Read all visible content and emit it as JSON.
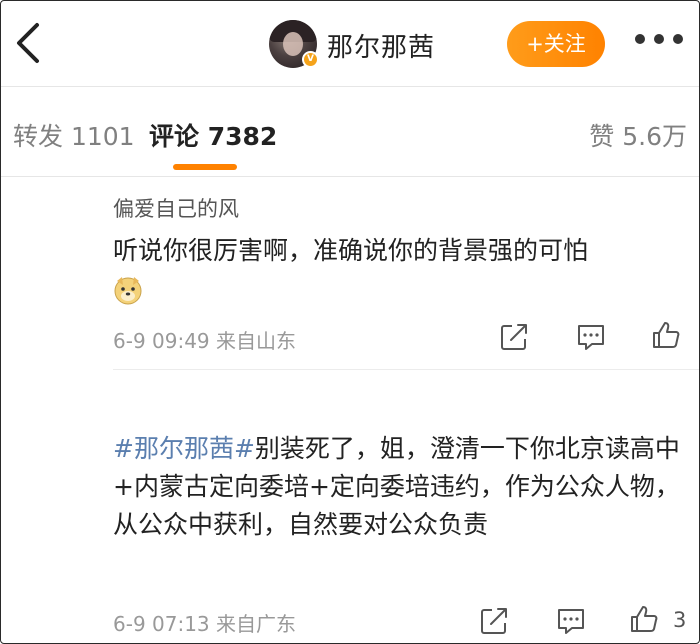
{
  "header": {
    "back_icon": "chevron-left-icon",
    "avatar_badge": "V",
    "username": "那尔那茜",
    "follow_label": "+关注",
    "more_icon": "more-icon"
  },
  "tabs": {
    "repost": "转发 1101",
    "comment": "评论 7382",
    "like": "赞 5.6万",
    "active_color": "#ff8200"
  },
  "comments": [
    {
      "author": "偏爱自己的风",
      "text": "听说你很厉害啊，准确说你的背景强的可怕",
      "emoji": "doge-emoji",
      "time": "6-9 09:49",
      "location": "来自山东",
      "like_count": ""
    },
    {
      "author": "",
      "hashtag": "#那尔那茜#",
      "text": "别装死了，姐，澄清一下你北京读高中+内蒙古定向委培+定向委培违约，作为公众人物，从公众中获利，自然要对公众负责",
      "time": "6-9 07:13",
      "location": "来自广东",
      "like_count": "3"
    }
  ]
}
